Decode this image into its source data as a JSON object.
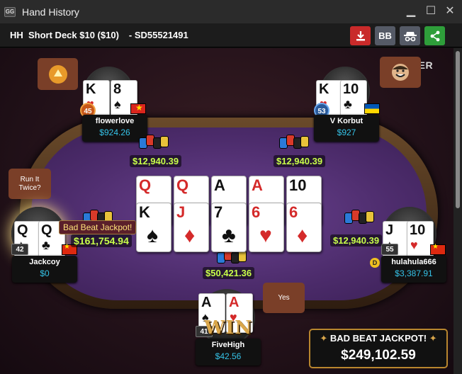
{
  "window": {
    "logo": "GG",
    "title": "Hand History",
    "controls": {
      "minimize": "▁",
      "maximize": "☐",
      "close": "✕"
    }
  },
  "hand": {
    "title": "HH  Short Deck $10 ($10)",
    "id": "- SD55521491"
  },
  "toolbar": {
    "download_icon": "download-icon",
    "bb_label": "BB",
    "incognito_icon": "incognito-icon",
    "share_icon": "share-icon",
    "colors": {
      "download": "#c92a2a",
      "bb": "#555a66",
      "incognito": "#555a66",
      "share": "#2e9e3a"
    }
  },
  "watermark": "GGPOKER",
  "bubbles": {
    "run_it_twice": "Run It\nTwice?",
    "yes": "Yes"
  },
  "players": {
    "flowerlove": {
      "name": "flowerlove",
      "stack": "$924.26",
      "level": "45",
      "card1_rank": "K",
      "card1_suit": "♥",
      "card2_rank": "8",
      "card2_suit": "♠",
      "flag": "Vietnam"
    },
    "vkorbut": {
      "name": "V Korbut",
      "stack": "$927",
      "level": "53",
      "card1_rank": "K",
      "card1_suit": "♥",
      "card2_rank": "10",
      "card2_suit": "♣",
      "flag": "Ukraine"
    },
    "jackcoy": {
      "name": "Jackcoy",
      "stack": "$0",
      "level": "42",
      "card1_rank": "Q",
      "card1_suit": "♠",
      "card2_rank": "Q",
      "card2_suit": "♣",
      "flag": "China"
    },
    "hulahula": {
      "name": "hulahula666",
      "stack": "$3,387.91",
      "level": "55",
      "card1_rank": "J",
      "card1_suit": "♠",
      "card2_rank": "10",
      "card2_suit": "♥",
      "flag": "China",
      "dealer": "D"
    },
    "fivehigh": {
      "name": "FiveHigh",
      "stack": "$42.56",
      "level": "41",
      "card1_rank": "A",
      "card1_suit": "♠",
      "card2_rank": "A",
      "card2_suit": "♥"
    }
  },
  "bets": {
    "flowerlove": "$12,940.39",
    "vkorbut": "$12,940.39",
    "jackcoy": "$161,754.94",
    "hulahula": "$12,940.39",
    "pot": "$50,421.36"
  },
  "board": {
    "run1": [
      {
        "rank": "Q",
        "suit": "♥",
        "color": "red"
      },
      {
        "rank": "Q",
        "suit": "♦",
        "color": "red"
      },
      {
        "rank": "A",
        "suit": "♣",
        "color": "black"
      },
      {
        "rank": "A",
        "suit": "♦",
        "color": "red"
      },
      {
        "rank": "10",
        "suit": "♠",
        "color": "black"
      }
    ],
    "run2": [
      {
        "rank": "K",
        "suit": "♠",
        "color": "black"
      },
      {
        "rank": "J",
        "suit": "♦",
        "color": "red"
      },
      {
        "rank": "7",
        "suit": "♣",
        "color": "black"
      },
      {
        "rank": "6",
        "suit": "♥",
        "color": "red"
      },
      {
        "rank": "6",
        "suit": "♦",
        "color": "red"
      }
    ]
  },
  "bad_beat_tag": "Bad Beat Jackpot!",
  "win_text": "WIN",
  "jackpot": {
    "title": "BAD BEAT JACKPOT!",
    "amount": "$249,102.59",
    "star": "✦"
  }
}
